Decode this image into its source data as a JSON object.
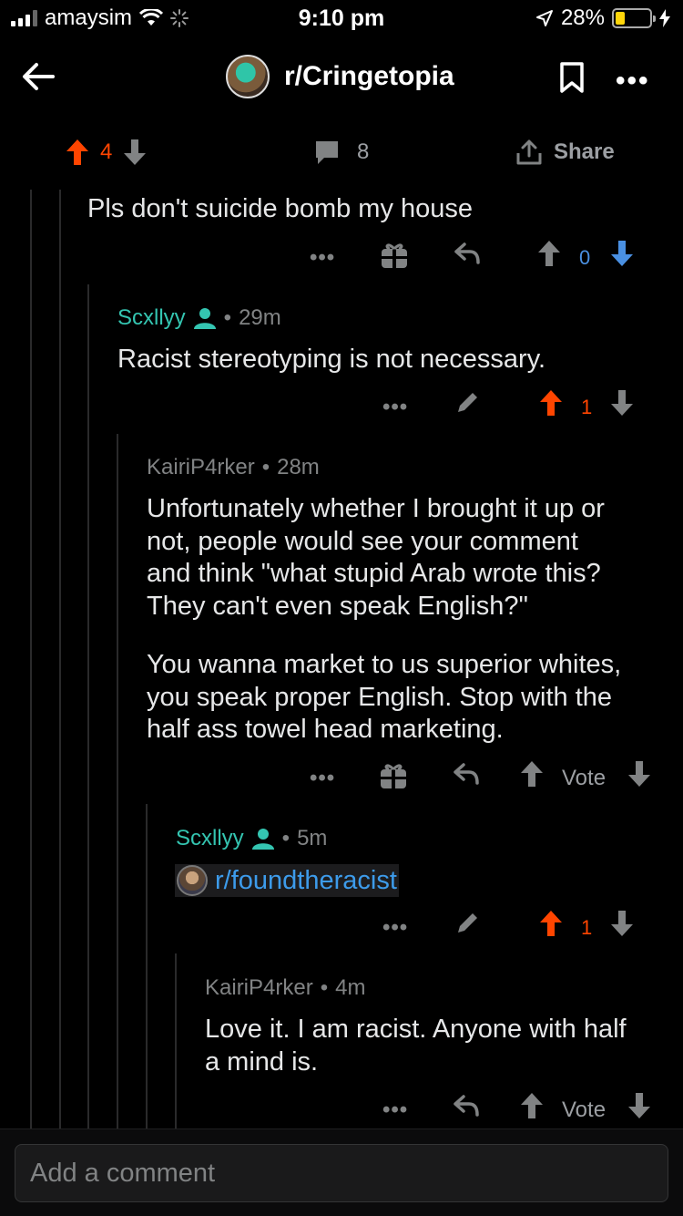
{
  "status": {
    "carrier": "amaysim",
    "time": "9:10 pm",
    "battery": "28%",
    "battery_level": 0.28
  },
  "header": {
    "subreddit": "r/Cringetopia"
  },
  "post_actions": {
    "score": "4",
    "comments": "8",
    "share_label": "Share"
  },
  "comments": [
    {
      "text": "Pls don't suicide bomb my house",
      "score": "0"
    },
    {
      "author": "Scxllyy",
      "time": "29m",
      "text": "Racist stereotyping is not necessary.",
      "score": "1"
    },
    {
      "author": "KairiP4rker",
      "time": "28m",
      "text_p1": [
        "Unfortunately whether I brought it up or",
        "not, people would see your comment",
        "and think \"what stupid Arab wrote this?",
        "They can't even speak English?\""
      ],
      "text_p2": [
        "You wanna market to us superior whites,",
        "you speak proper English. Stop with the",
        "half ass towel head marketing."
      ],
      "vote_label": "Vote"
    },
    {
      "author": "Scxllyy",
      "time": "5m",
      "link": "r/foundtheracist",
      "score": "1"
    },
    {
      "author": "KairiP4rker",
      "time": "4m",
      "text": [
        "Love it. I am racist. Anyone with half",
        "a mind is."
      ],
      "vote_label": "Vote"
    }
  ],
  "comment_box": {
    "placeholder": "Add a comment"
  },
  "colors": {
    "upvote": "#ff4500",
    "downvote_active": "#4a90e2",
    "op_name": "#34c5b1",
    "link": "#3d9bea"
  }
}
